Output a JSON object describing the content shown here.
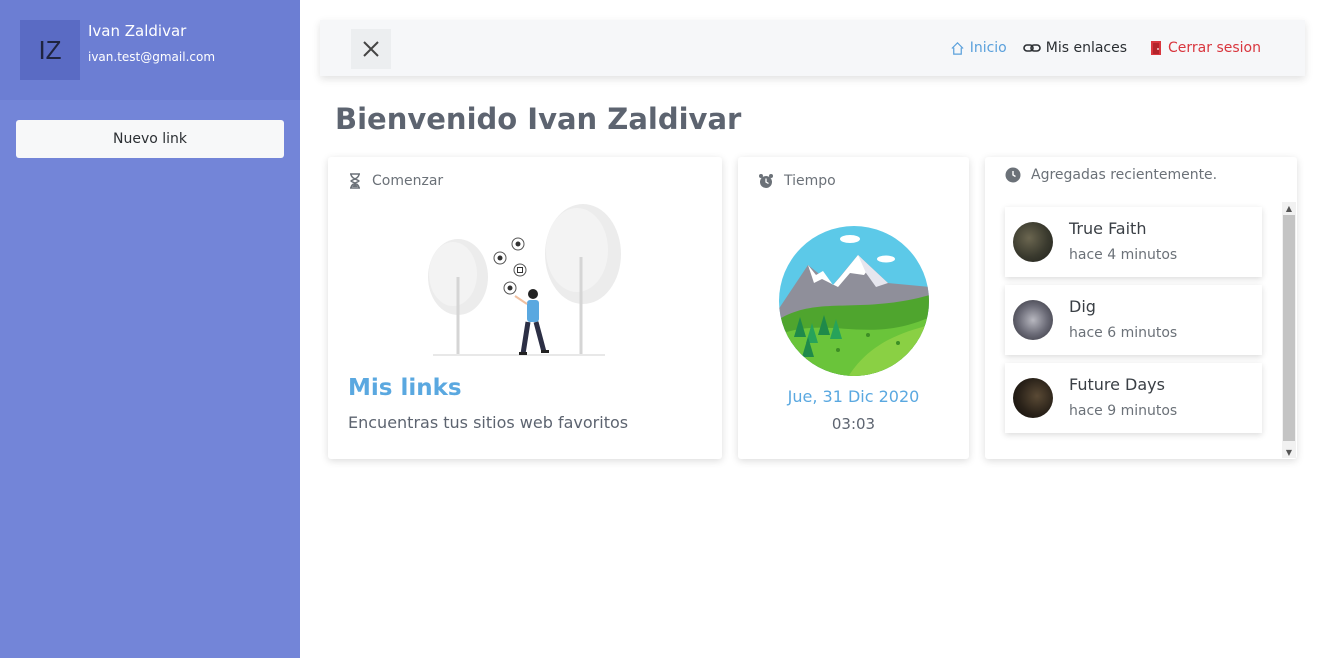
{
  "user": {
    "initials": "IZ",
    "name": "Ivan Zaldivar",
    "email": "ivan.test@gmail.com"
  },
  "sidebar": {
    "new_link_label": "Nuevo link"
  },
  "nav": {
    "inicio": "Inicio",
    "mis_enlaces": "Mis enlaces",
    "cerrar_sesion": "Cerrar sesion"
  },
  "page_title": "Bienvenido Ivan Zaldivar",
  "cards": {
    "start": {
      "header": "Comenzar",
      "title": "Mis links",
      "description": "Encuentras tus sitios web favoritos"
    },
    "time": {
      "header": "Tiempo",
      "date": "Jue, 31 Dic 2020",
      "clock": "03:03"
    },
    "recent": {
      "header": "Agregadas recientemente.",
      "items": [
        {
          "title": "True Faith",
          "time": "hace 4 minutos"
        },
        {
          "title": "Dig",
          "time": "hace 6 minutos"
        },
        {
          "title": "Future Days",
          "time": "hace 9 minutos"
        }
      ]
    }
  },
  "colors": {
    "sidebar": "#7385d8",
    "accent_blue": "#5aa8e0",
    "logout_red": "#d9363e"
  },
  "icons": {
    "close": "close-icon",
    "home": "home-icon",
    "link": "link-icon",
    "door": "door-icon",
    "hourglass": "hourglass-icon",
    "alarm": "alarm-clock-icon",
    "clock": "clock-icon"
  }
}
